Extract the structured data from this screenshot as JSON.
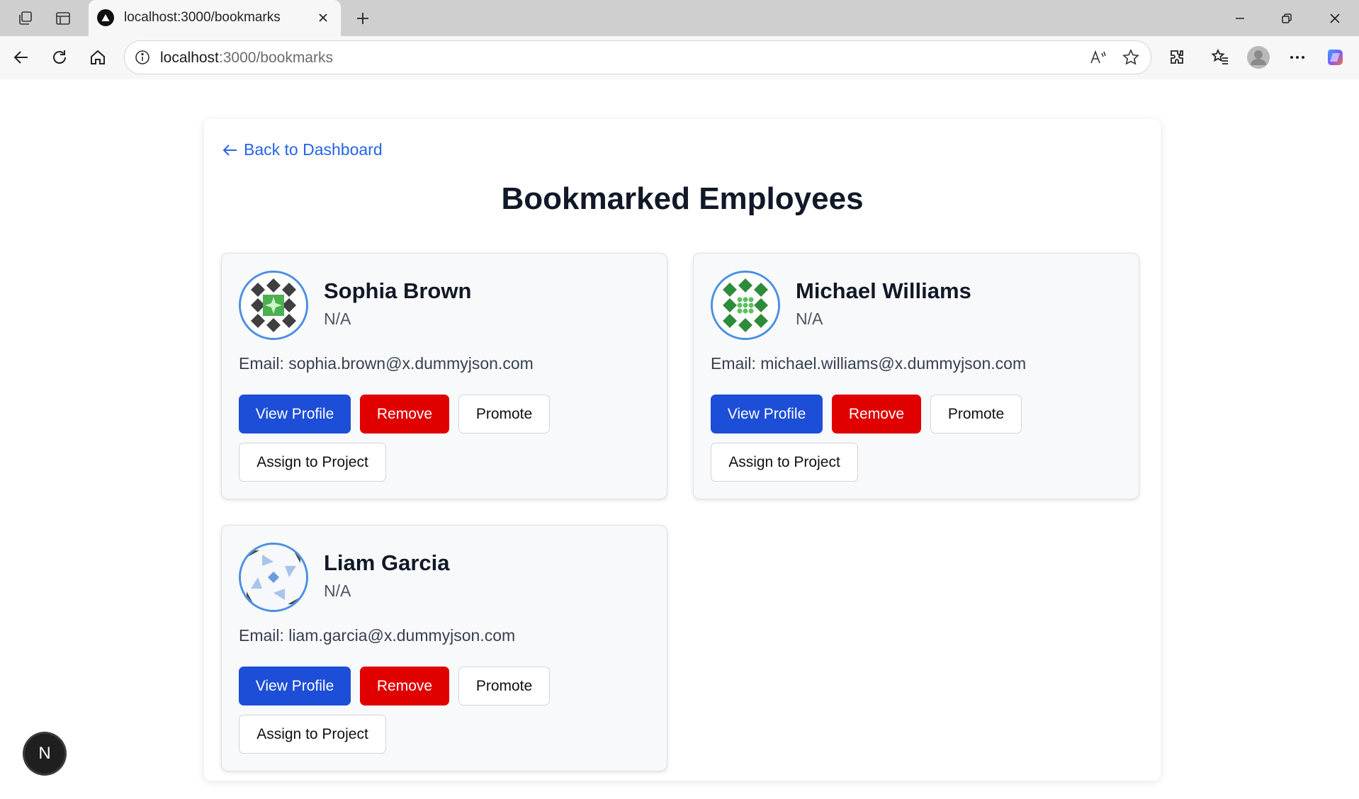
{
  "browser": {
    "tab_title": "localhost:3000/bookmarks",
    "url_host": "localhost",
    "url_path": ":3000/bookmarks"
  },
  "page": {
    "back_link": "Back to Dashboard",
    "title": "Bookmarked Employees"
  },
  "employees": [
    {
      "name": "Sophia Brown",
      "role": "N/A",
      "email_label": "Email: sophia.brown@x.dummyjson.com"
    },
    {
      "name": "Michael Williams",
      "role": "N/A",
      "email_label": "Email: michael.williams@x.dummyjson.com"
    },
    {
      "name": "Liam Garcia",
      "role": "N/A",
      "email_label": "Email: liam.garcia@x.dummyjson.com"
    }
  ],
  "actions": {
    "view_profile": "View Profile",
    "remove": "Remove",
    "promote": "Promote",
    "assign": "Assign to Project"
  },
  "dev_badge": "N",
  "colors": {
    "primary": "#1d4ed8",
    "danger": "#e00000",
    "link": "#2563eb"
  }
}
